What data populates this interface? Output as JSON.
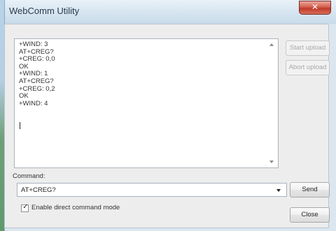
{
  "window": {
    "title": "WebComm Utility",
    "close_glyph": "✕"
  },
  "output": {
    "text": "+WIND: 3\nAT+CREG?\n+CREG: 0,0\nOK\n+WIND: 1\nAT+CREG?\n+CREG: 0,2\nOK\n+WIND: 4"
  },
  "buttons": {
    "start_upload": "Start upload",
    "abort_upload": "Abort upload",
    "send": "Send",
    "close": "Close"
  },
  "command": {
    "label": "Command:",
    "value": "AT+CREG?"
  },
  "direct_mode": {
    "label": "Enable direct command mode",
    "checked": true,
    "check_glyph": "✓"
  },
  "colors": {
    "title_close_red": "#c0392b",
    "disabled_text": "#a8a8a8"
  }
}
